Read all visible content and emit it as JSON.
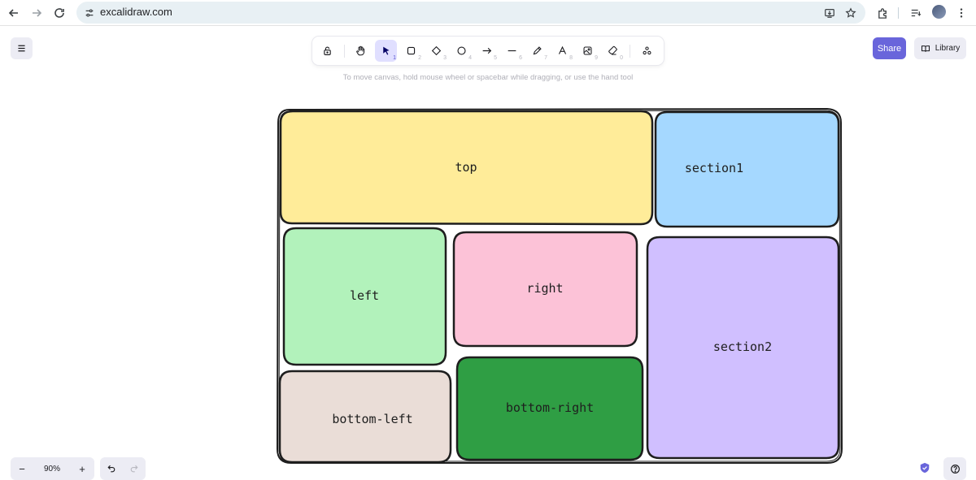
{
  "browser": {
    "url": "excalidraw.com",
    "icons": [
      "back-arrow-icon",
      "forward-arrow-icon",
      "reload-icon",
      "site-info-icon",
      "install-app-icon",
      "bookmark-star-icon",
      "extensions-icon",
      "media-queue-icon",
      "profile-avatar",
      "more-menu-icon"
    ]
  },
  "toolbar": {
    "tools": [
      {
        "name": "lock",
        "key": ""
      },
      {
        "name": "hand",
        "key": ""
      },
      {
        "name": "selection",
        "key": "1"
      },
      {
        "name": "rectangle",
        "key": "2"
      },
      {
        "name": "diamond",
        "key": "3"
      },
      {
        "name": "ellipse",
        "key": "4"
      },
      {
        "name": "arrow",
        "key": "5"
      },
      {
        "name": "line",
        "key": "6"
      },
      {
        "name": "draw",
        "key": "7"
      },
      {
        "name": "text",
        "key": "8"
      },
      {
        "name": "image",
        "key": "9"
      },
      {
        "name": "eraser",
        "key": "0"
      },
      {
        "name": "more-tools",
        "key": ""
      }
    ],
    "active_tool": "selection",
    "hint": "To move canvas, hold mouse wheel or spacebar while dragging, or use the hand tool"
  },
  "header": {
    "share_label": "Share",
    "library_label": "Library"
  },
  "footer": {
    "zoom_level": "90%",
    "zoom_out": "−",
    "zoom_in": "+"
  },
  "canvas": {
    "shapes": [
      {
        "label": "top",
        "fill": "#ffec99"
      },
      {
        "label": "section1",
        "fill": "#a5d8ff"
      },
      {
        "label": "left",
        "fill": "#b2f2bb"
      },
      {
        "label": "right",
        "fill": "#fcc2d7"
      },
      {
        "label": "section2",
        "fill": "#d0bfff"
      },
      {
        "label": "bottom-left",
        "fill": "#eaddd7"
      },
      {
        "label": "bottom-right",
        "fill": "#2f9e44"
      }
    ],
    "stroke": "#1e1e1e",
    "accent": "#6965db"
  }
}
